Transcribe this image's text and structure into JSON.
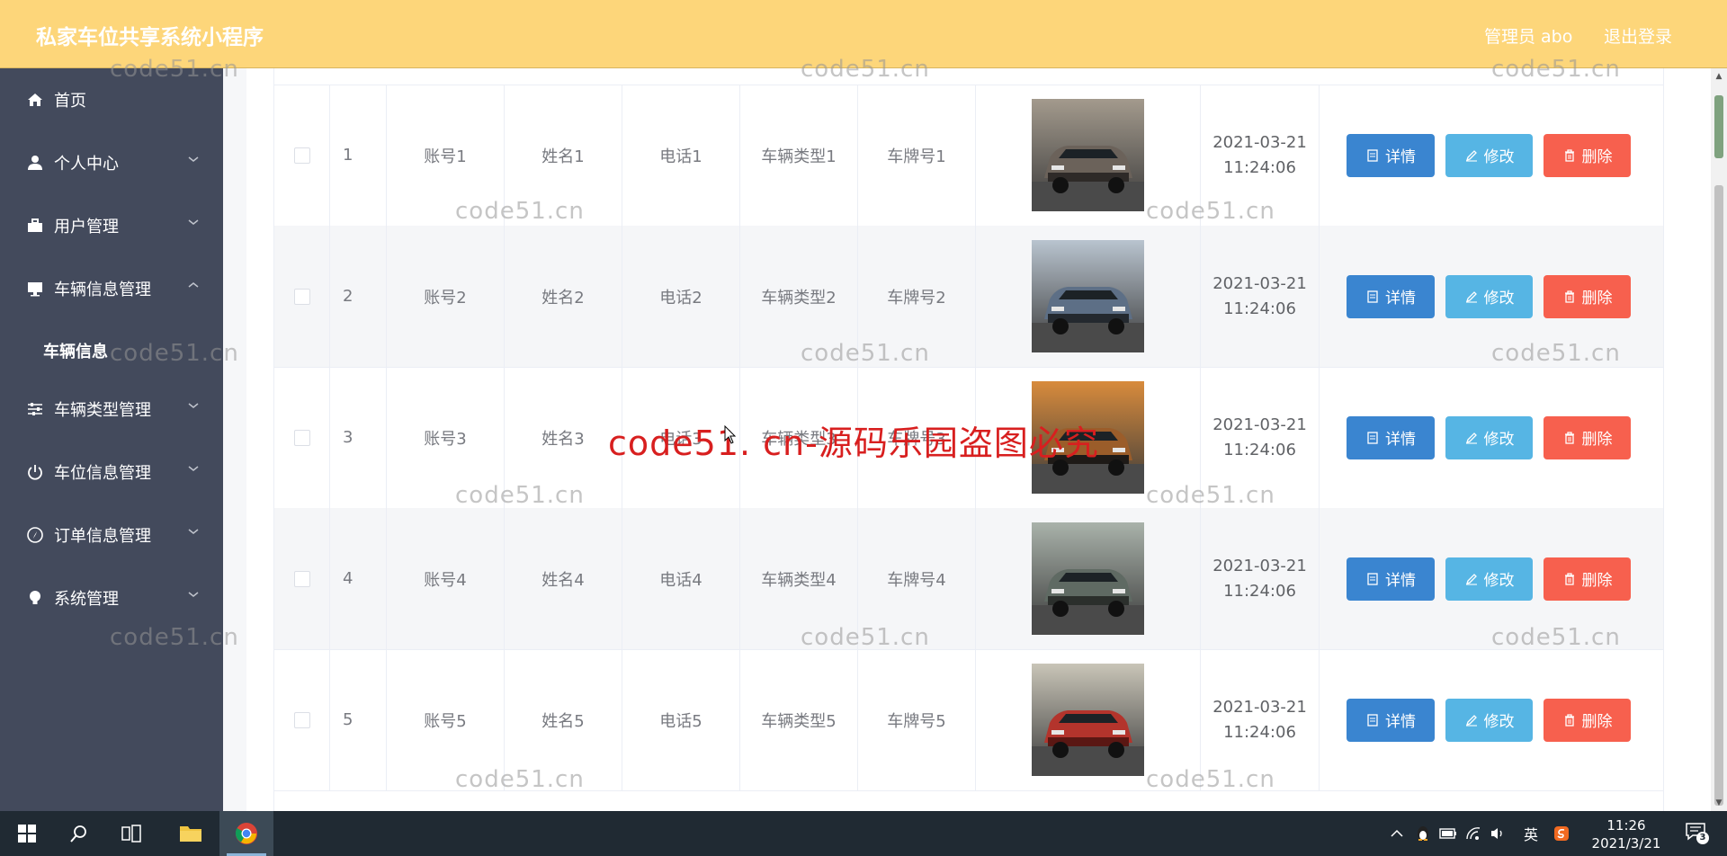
{
  "header": {
    "title": "私家车位共享系统小程序",
    "user": "管理员 abo",
    "logout": "退出登录"
  },
  "sidebar": {
    "items": [
      {
        "label": "首页",
        "icon": "home-icon"
      },
      {
        "label": "个人中心",
        "icon": "user-icon"
      },
      {
        "label": "用户管理",
        "icon": "briefcase-icon"
      },
      {
        "label": "车辆信息管理",
        "icon": "monitor-icon",
        "expanded": true,
        "children": [
          {
            "label": "车辆信息"
          }
        ]
      },
      {
        "label": "车辆类型管理",
        "icon": "sliders-icon"
      },
      {
        "label": "车位信息管理",
        "icon": "power-icon"
      },
      {
        "label": "订单信息管理",
        "icon": "compass-icon"
      },
      {
        "label": "系统管理",
        "icon": "lightbulb-icon"
      }
    ]
  },
  "table": {
    "rows": [
      {
        "index": "1",
        "account": "账号1",
        "name": "姓名1",
        "phone": "电话1",
        "type": "车辆类型1",
        "plate": "车牌号1",
        "date": "2021-03-21",
        "time": "11:24:06"
      },
      {
        "index": "2",
        "account": "账号2",
        "name": "姓名2",
        "phone": "电话2",
        "type": "车辆类型2",
        "plate": "车牌号2",
        "date": "2021-03-21",
        "time": "11:24:06"
      },
      {
        "index": "3",
        "account": "账号3",
        "name": "姓名3",
        "phone": "电话3",
        "type": "车辆类型3",
        "plate": "车牌号3",
        "date": "2021-03-21",
        "time": "11:24:06"
      },
      {
        "index": "4",
        "account": "账号4",
        "name": "姓名4",
        "phone": "电话4",
        "type": "车辆类型4",
        "plate": "车牌号4",
        "date": "2021-03-21",
        "time": "11:24:06"
      },
      {
        "index": "5",
        "account": "账号5",
        "name": "姓名5",
        "phone": "电话5",
        "type": "车辆类型5",
        "plate": "车牌号5",
        "date": "2021-03-21",
        "time": "11:24:06"
      }
    ],
    "actions": {
      "detail": "详情",
      "edit": "修改",
      "delete": "删除"
    }
  },
  "watermark": {
    "small": "code51.cn",
    "big": "code51. cn-源码乐园盗图必究"
  },
  "taskbar": {
    "ime": "英",
    "time": "11:26",
    "date": "2021/3/21",
    "notifications": "3"
  },
  "colors": {
    "header": "#fdd67a",
    "sidebar": "#434a5c",
    "detail_button": "#3a85d0",
    "edit_button": "#56b5e4",
    "delete_button": "#f7604e",
    "watermark_big": "#d81f1f"
  }
}
